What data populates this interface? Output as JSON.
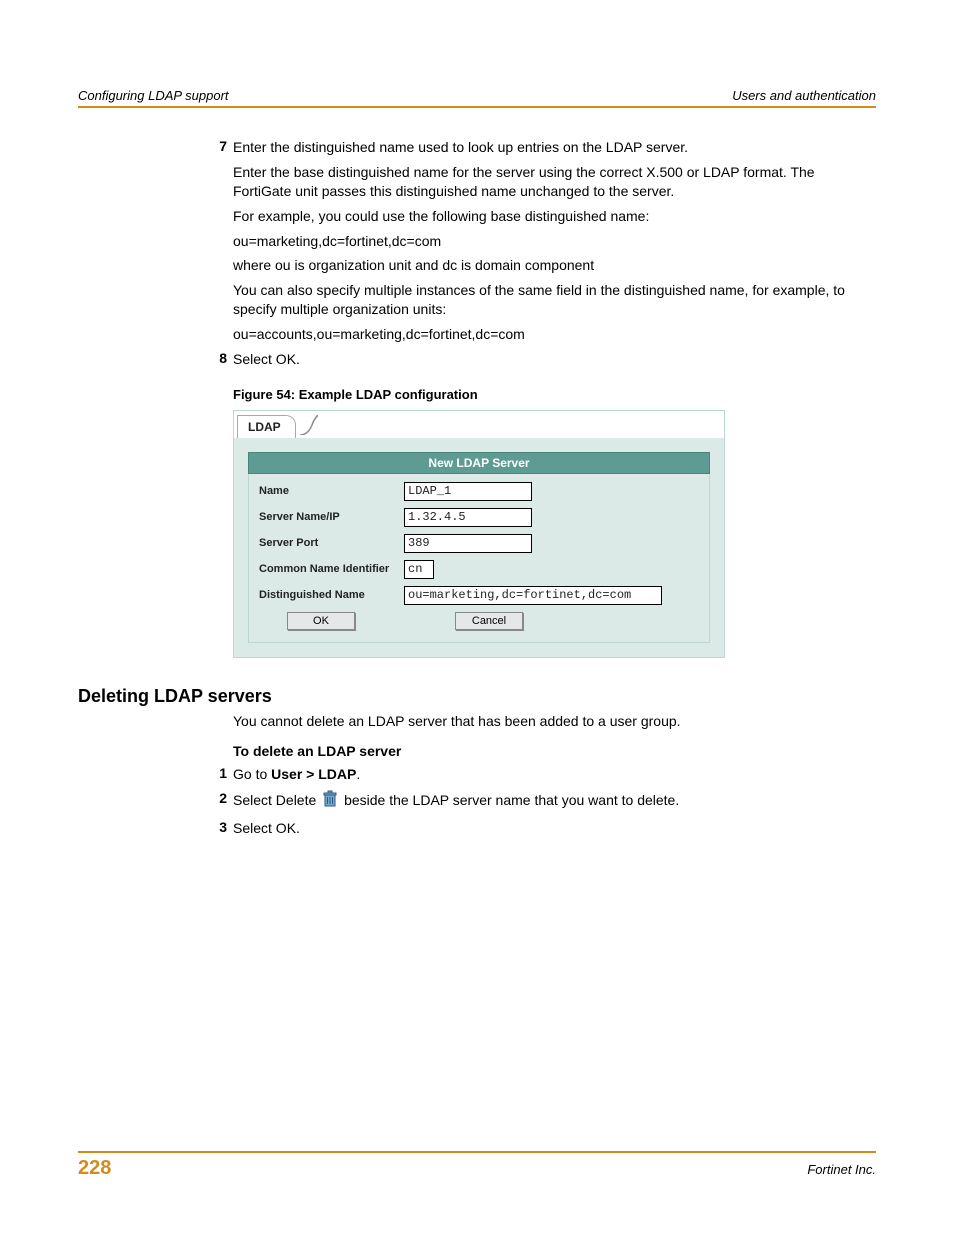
{
  "header": {
    "left": "Configuring LDAP support",
    "right": "Users and authentication"
  },
  "steps": {
    "s7": {
      "num": "7",
      "p1": "Enter the distinguished name used to look up entries on the LDAP server.",
      "p2": "Enter the base distinguished name for the server using the correct X.500 or LDAP format. The FortiGate unit passes this distinguished name unchanged to the server.",
      "p3": "For example, you could use the following base distinguished name:",
      "p4": "ou=marketing,dc=fortinet,dc=com",
      "p5": "where ou is organization unit and dc is domain component",
      "p6": "You can also specify multiple instances of the same field in the distinguished name, for example, to specify multiple organization units:",
      "p7": "ou=accounts,ou=marketing,dc=fortinet,dc=com"
    },
    "s8": {
      "num": "8",
      "p1": "Select OK."
    }
  },
  "figure": {
    "caption": "Figure 54: Example LDAP configuration",
    "tab": "LDAP",
    "title": "New LDAP Server",
    "fields": {
      "name_lbl": "Name",
      "name_val": "LDAP_1",
      "server_lbl": "Server Name/IP",
      "server_val": "1.32.4.5",
      "port_lbl": "Server Port",
      "port_val": "389",
      "cn_lbl": "Common Name Identifier",
      "cn_val": "cn",
      "dn_lbl": "Distinguished Name",
      "dn_val": "ou=marketing,dc=fortinet,dc=com"
    },
    "ok": "OK",
    "cancel": "Cancel"
  },
  "section2": {
    "heading": "Deleting LDAP servers",
    "intro": "You cannot delete an LDAP server that has been added to a user group.",
    "subhead": "To delete an LDAP server",
    "d1": {
      "num": "1",
      "a": "Go to ",
      "b": "User > LDAP",
      "c": "."
    },
    "d2": {
      "num": "2",
      "a": "Select Delete ",
      "b": " beside the LDAP server name that you want to delete."
    },
    "d3": {
      "num": "3",
      "a": "Select OK."
    }
  },
  "footer": {
    "page": "228",
    "right": "Fortinet Inc."
  }
}
